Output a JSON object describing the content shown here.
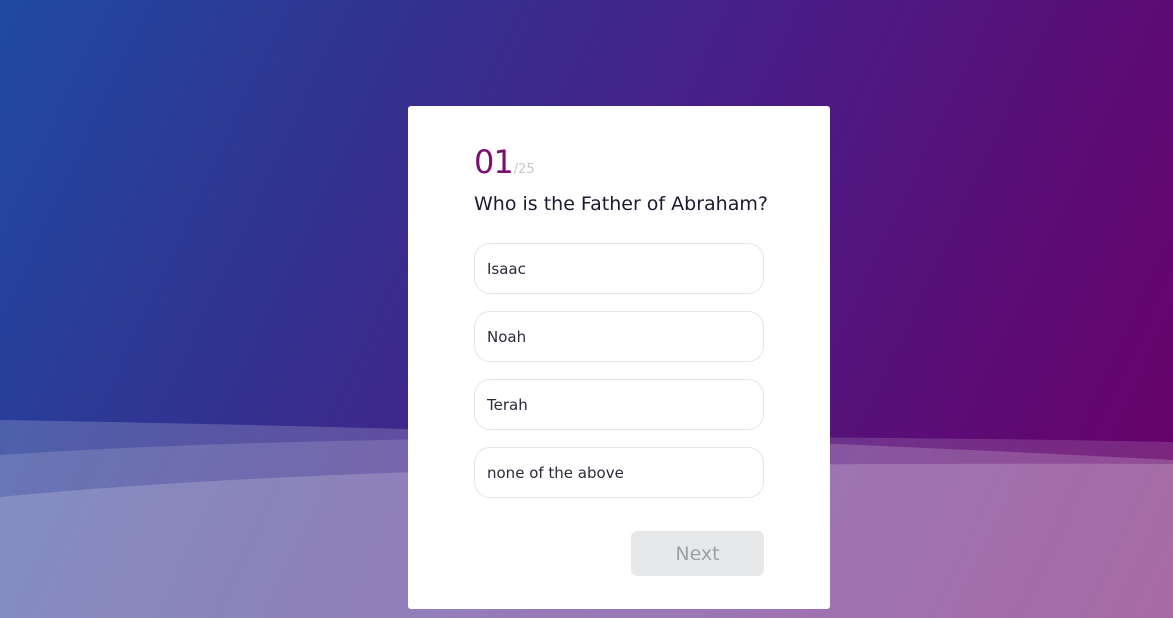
{
  "quiz": {
    "current_number": "01",
    "total_label": "/25",
    "progress": {
      "current": 1,
      "total": 25
    },
    "question": "Who is the Father of Abraham?",
    "options": [
      {
        "label": "Isaac"
      },
      {
        "label": "Noah"
      },
      {
        "label": "Terah"
      },
      {
        "label": "none of the above"
      }
    ],
    "next_label": "Next",
    "next_disabled": true
  },
  "colors": {
    "accent": "#7a106e",
    "background_start": "#1f4aa2",
    "background_end": "#6a0066",
    "button_disabled_bg": "#e7e8ea",
    "button_disabled_text": "#9d9fa4"
  }
}
